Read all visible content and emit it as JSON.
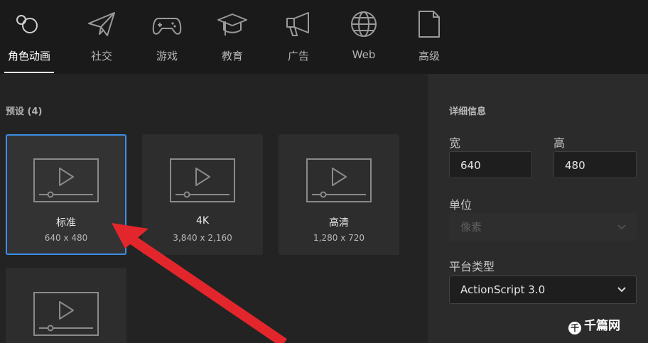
{
  "tabs": [
    {
      "label": "角色动画",
      "icon": "character-animation-icon",
      "active": true
    },
    {
      "label": "社交",
      "icon": "paper-plane-icon"
    },
    {
      "label": "游戏",
      "icon": "gamepad-icon"
    },
    {
      "label": "教育",
      "icon": "graduation-cap-icon"
    },
    {
      "label": "广告",
      "icon": "megaphone-icon"
    },
    {
      "label": "Web",
      "icon": "globe-icon"
    },
    {
      "label": "高级",
      "icon": "document-icon"
    }
  ],
  "presets": {
    "title": "预设 (4)",
    "items": [
      {
        "name": "标准",
        "size": "640 x 480",
        "selected": true
      },
      {
        "name": "4K",
        "size": "3,840 x 2,160"
      },
      {
        "name": "高清",
        "size": "1,280 x 720"
      },
      {
        "name": "",
        "size": ""
      }
    ]
  },
  "details": {
    "title": "详细信息",
    "width_label": "宽",
    "width_value": "640",
    "height_label": "高",
    "height_value": "480",
    "unit_label": "单位",
    "unit_value": "像素",
    "platform_label": "平台类型",
    "platform_value": "ActionScript 3.0"
  },
  "watermark": {
    "logo_text": "千",
    "text": "千篇网"
  },
  "colors": {
    "selection_border": "#3b8fe6",
    "arrow": "#e3262b"
  }
}
